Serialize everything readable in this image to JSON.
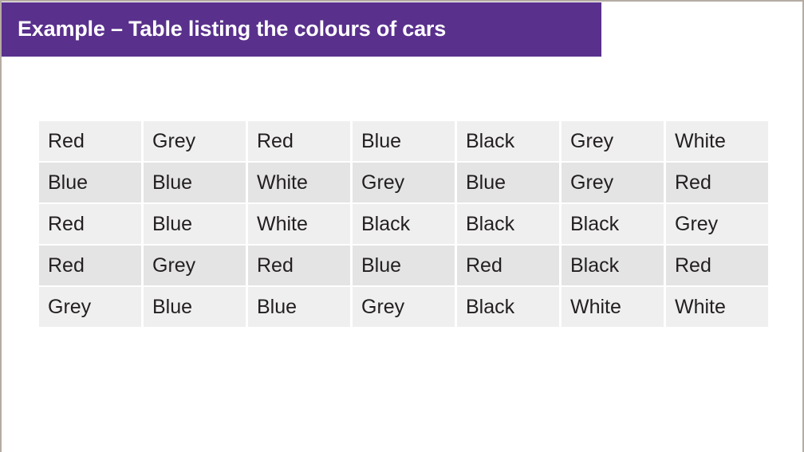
{
  "slide": {
    "background_color": "#ffffff",
    "border_color": "#b4aca3"
  },
  "title": {
    "text": "Example – Table listing the colours of cars",
    "background_color": "#59308c",
    "text_color": "#ffffff"
  },
  "table": {
    "row_count": 5,
    "column_count": 7,
    "cell_text_color": "#231f20",
    "row_fill_light": "#efefef",
    "row_fill_dark": "#e4e4e4",
    "rows": [
      [
        "Red",
        "Grey",
        "Red",
        "Blue",
        "Black",
        "Grey",
        "White"
      ],
      [
        "Blue",
        "Blue",
        "White",
        "Grey",
        "Blue",
        "Grey",
        "Red"
      ],
      [
        "Red",
        "Blue",
        "White",
        "Black",
        "Black",
        "Black",
        "Grey"
      ],
      [
        "Red",
        "Grey",
        "Red",
        "Blue",
        "Red",
        "Black",
        "Red"
      ],
      [
        "Grey",
        "Blue",
        "Blue",
        "Grey",
        "Black",
        "White",
        "White"
      ]
    ]
  }
}
